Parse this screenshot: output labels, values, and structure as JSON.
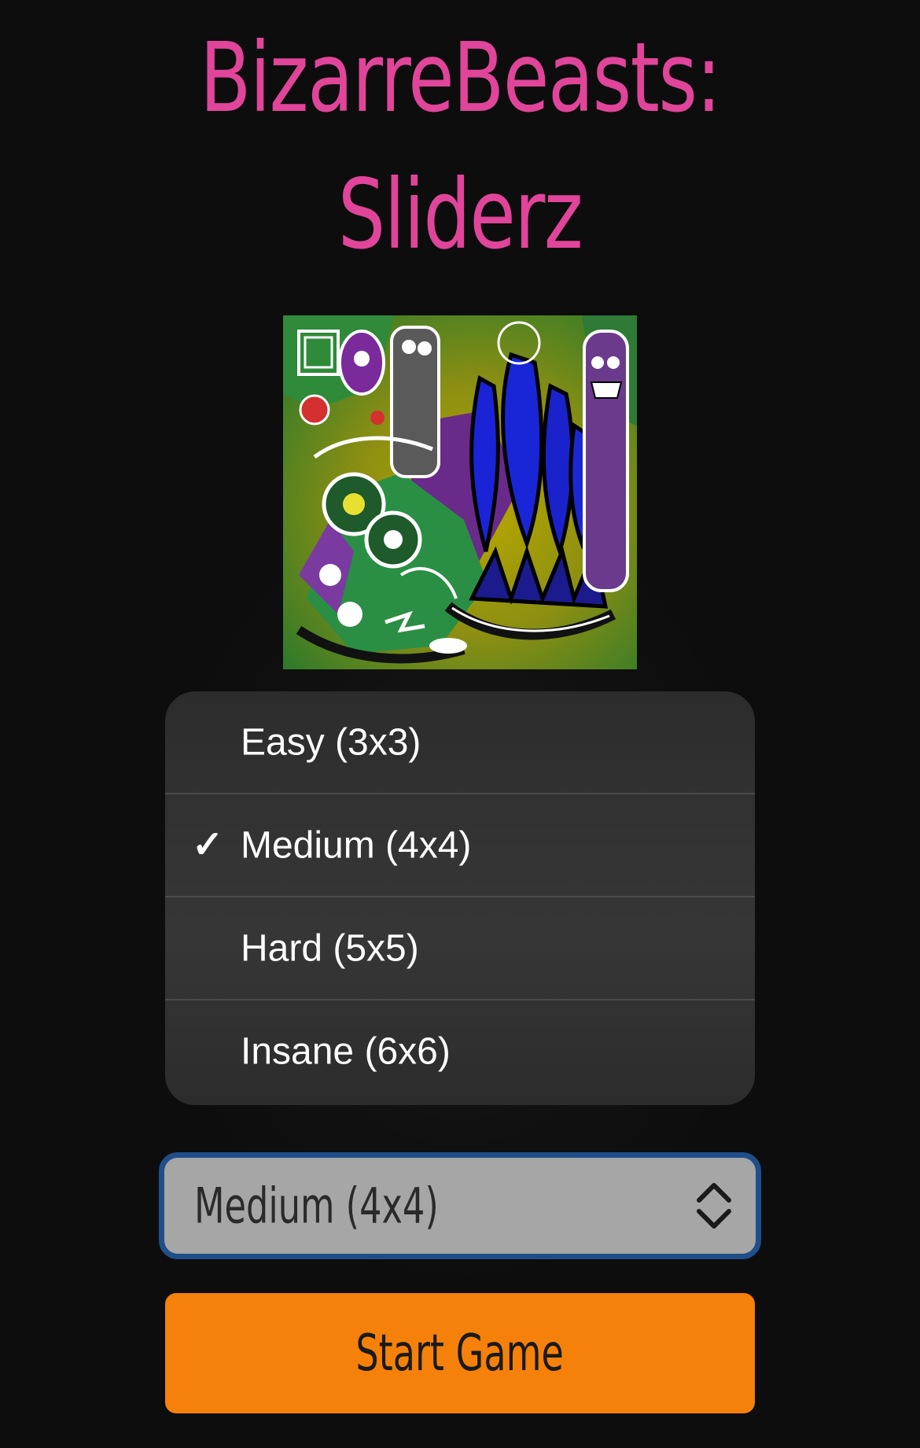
{
  "title": {
    "line1": "BizarreBeasts:",
    "line2": "Sliderz"
  },
  "colors": {
    "background": "#0d0d0d",
    "title": "#e0459a",
    "menu_background": "#333333",
    "select_background": "#a6a6a6",
    "select_focus_border": "#1f4f8a",
    "start_button": "#f5810a"
  },
  "difficulty_menu": {
    "items": [
      {
        "label": "Easy (3x3)",
        "checked": false
      },
      {
        "label": "Medium (4x4)",
        "checked": true
      },
      {
        "label": "Hard (5x5)",
        "checked": false
      },
      {
        "label": "Insane (6x6)",
        "checked": false
      }
    ],
    "check_glyph": "✓"
  },
  "difficulty_select": {
    "value": "Medium (4x4)",
    "icon": "chevron-up-down-icon"
  },
  "start_button": {
    "label": "Start Game"
  }
}
